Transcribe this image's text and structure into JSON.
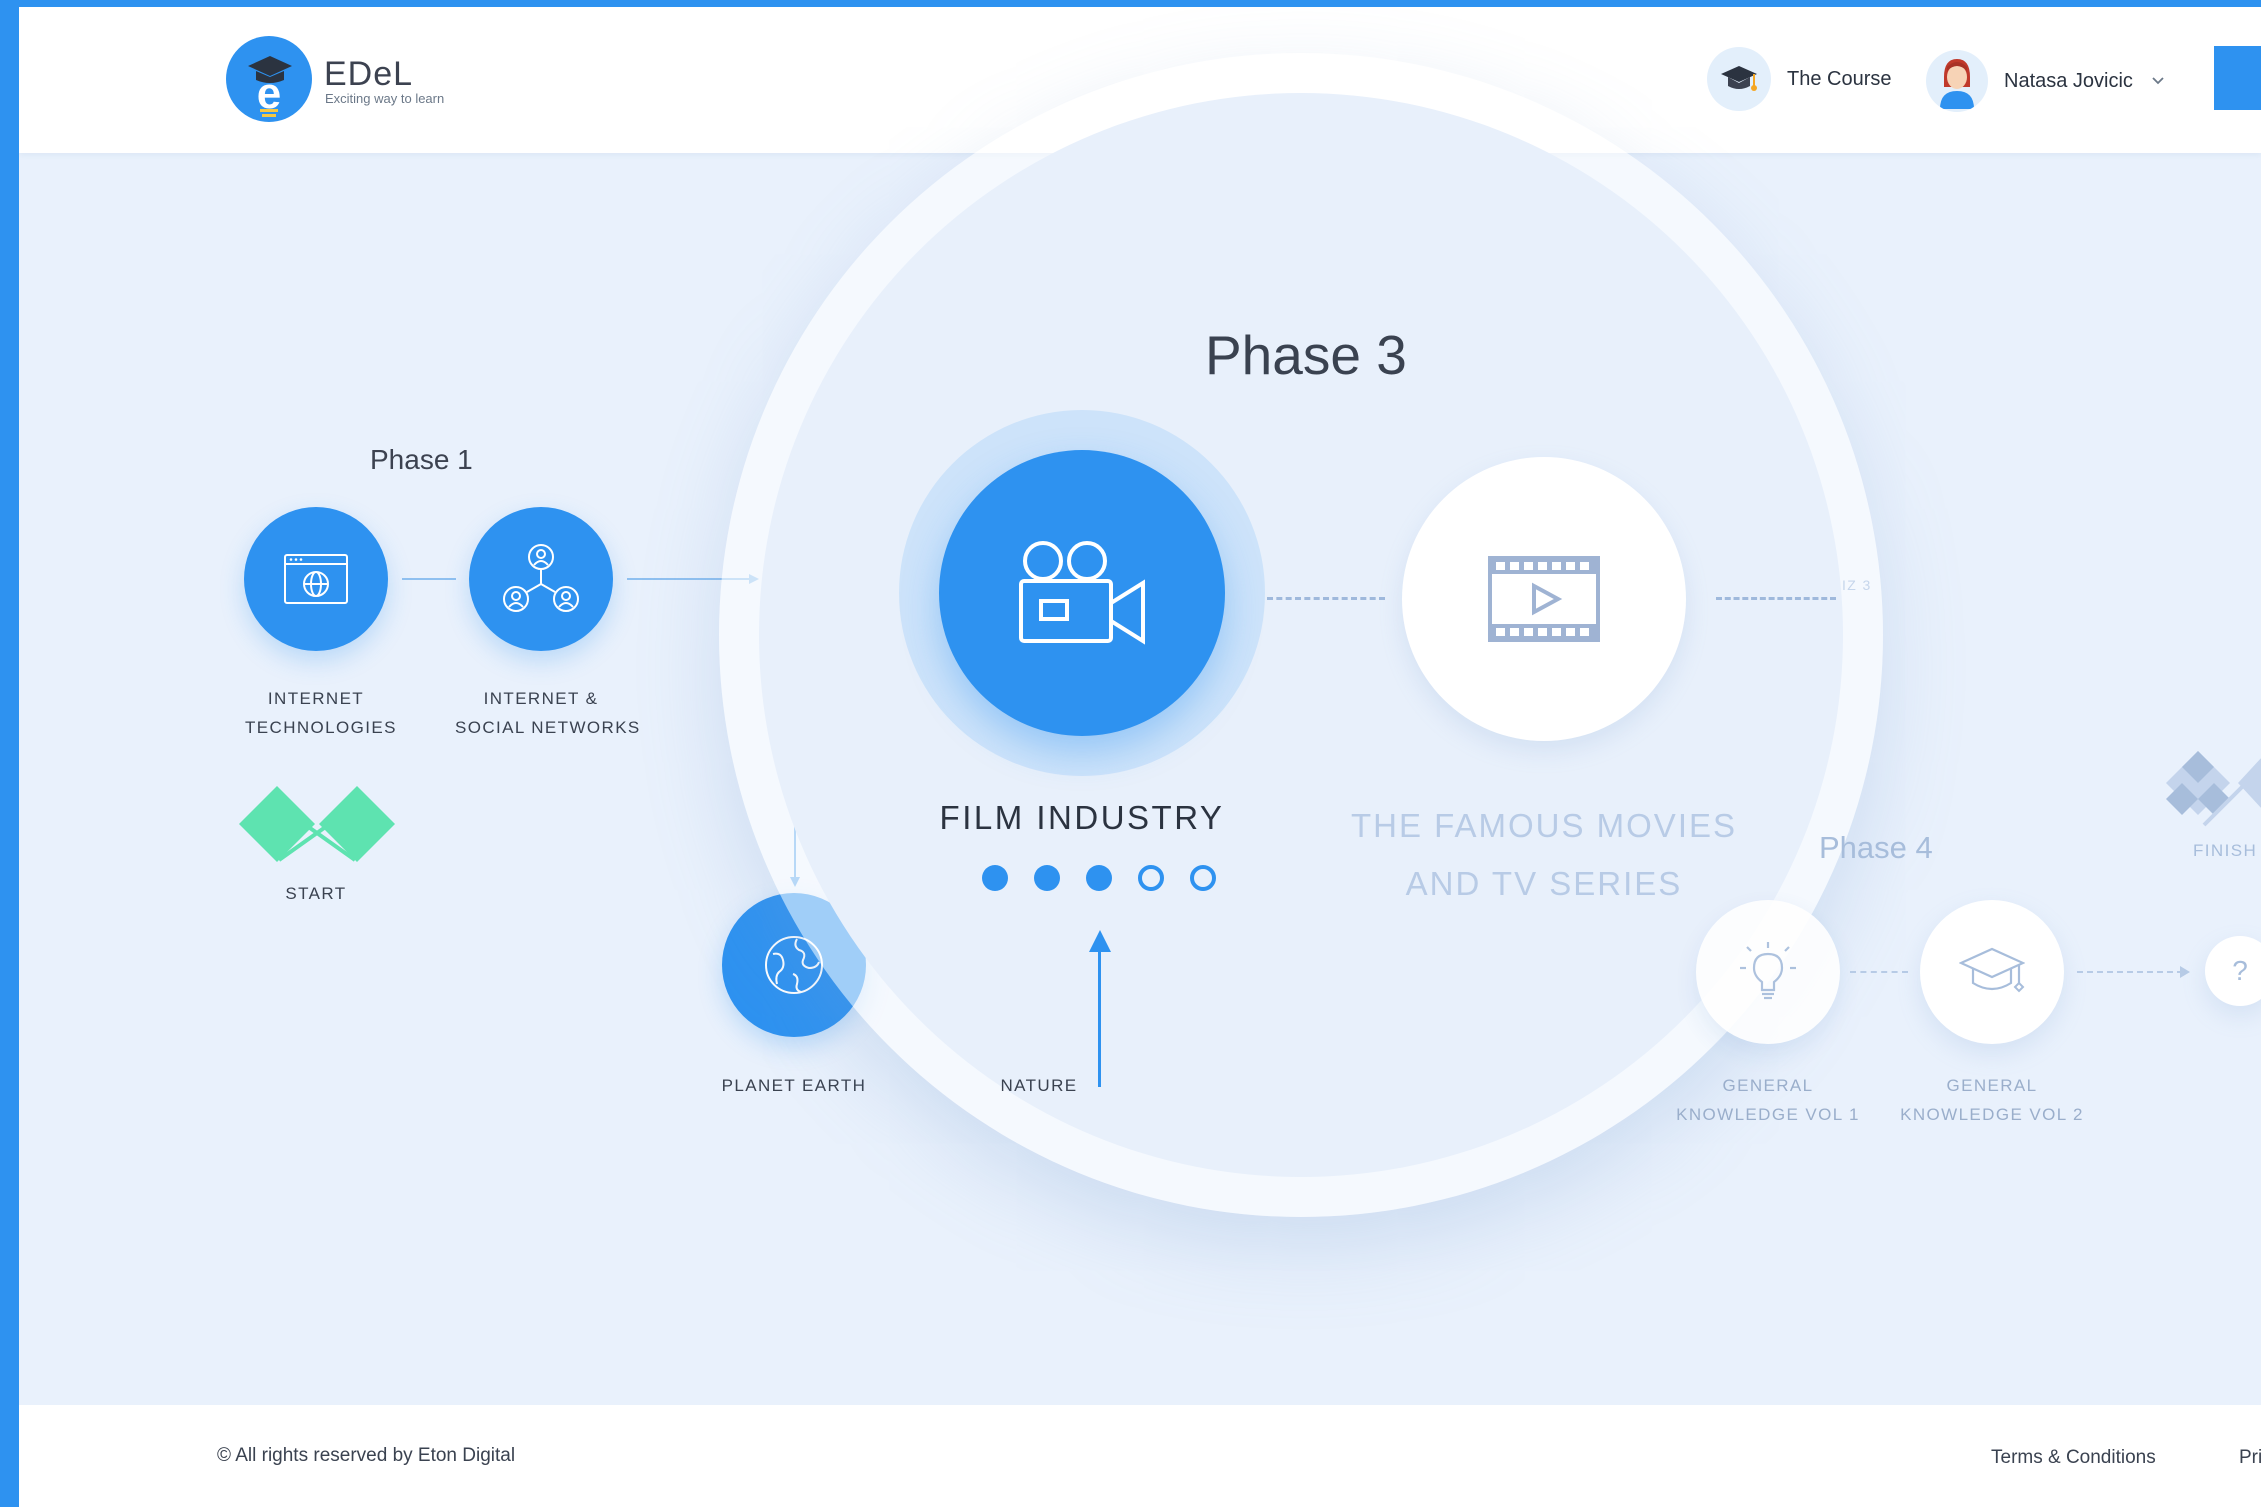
{
  "brand": {
    "name": "EDeL",
    "tagline": "Exciting way to learn"
  },
  "header": {
    "course_label": "The Course",
    "user_name": "Natasa Jovicic"
  },
  "phases": {
    "phase1": "Phase 1",
    "phase3": "Phase 3",
    "phase4": "Phase 4"
  },
  "nodes": {
    "internet_technologies": [
      "INTERNET",
      "TECHNOLOGIES"
    ],
    "internet_social": [
      "INTERNET &",
      "SOCIAL NETWORKS"
    ],
    "start": "START",
    "planet_earth": "PLANET EARTH",
    "nature": "NATURE",
    "film_industry": "FILM INDUSTRY",
    "famous_movies": [
      "THE FAMOUS MOVIES",
      "AND TV SERIES"
    ],
    "quiz_fragment": "IZ 3",
    "general_knowledge_1": [
      "GENERAL",
      "KNOWLEDGE VOL 1"
    ],
    "general_knowledge_2": [
      "GENERAL",
      "KNOWLEDGE VOL 2"
    ],
    "finish": "FINISH",
    "question_mark": "?"
  },
  "progress": {
    "completed": 3,
    "total": 5
  },
  "footer": {
    "copyright": "© All rights reserved by Eton Digital",
    "terms": "Terms & Conditions",
    "privacy_fragment": "Pri"
  },
  "colors": {
    "primary": "#2e92f0",
    "background": "#e9f1fc",
    "start_flag": "#5ee3b0",
    "muted_text": "#9aaecb"
  },
  "icons": {
    "logo": "graduation-cap-e-logo",
    "course": "graduation-cap-icon",
    "internet_technologies": "browser-globe-icon",
    "internet_social": "social-network-icon",
    "planet_earth": "globe-icon",
    "film_industry": "movie-camera-icon",
    "famous_movies": "film-strip-play-icon",
    "general_knowledge_1": "lightbulb-icon",
    "general_knowledge_2": "graduation-cap-outline-icon",
    "start": "start-flags-icon",
    "finish": "checkered-flags-icon"
  }
}
